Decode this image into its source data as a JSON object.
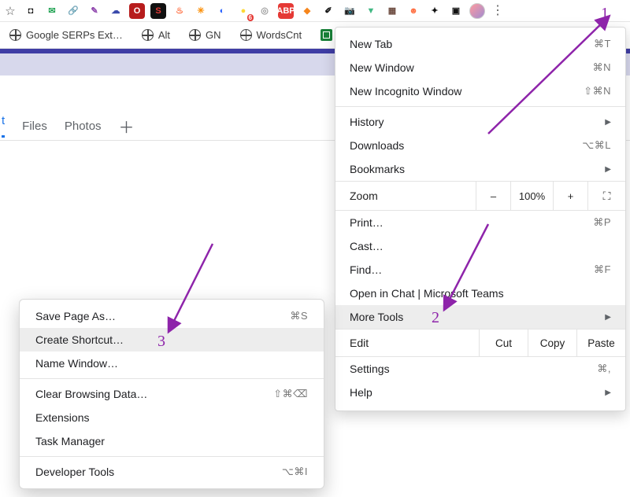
{
  "toolbar": {
    "extensions": [
      {
        "name": "onepass",
        "bg": "#fff",
        "fg": "#111",
        "glyph": "◘"
      },
      {
        "name": "mail",
        "bg": "#fff",
        "fg": "#23a455",
        "glyph": "✉"
      },
      {
        "name": "link",
        "bg": "#fff",
        "fg": "#2aa9e0",
        "glyph": "🔗"
      },
      {
        "name": "feather",
        "bg": "#fff",
        "fg": "#8e44ad",
        "glyph": "✎"
      },
      {
        "name": "bubble",
        "bg": "#fff",
        "fg": "#3949ab",
        "glyph": "☁"
      },
      {
        "name": "ublock",
        "bg": "#b71c1c",
        "fg": "#fff",
        "glyph": "O"
      },
      {
        "name": "seo",
        "bg": "#111",
        "fg": "#e53935",
        "glyph": "S"
      },
      {
        "name": "flame",
        "bg": "#fff",
        "fg": "#ff7043",
        "glyph": "♨"
      },
      {
        "name": "gear",
        "bg": "#fff",
        "fg": "#fb8c00",
        "glyph": "✳"
      },
      {
        "name": "similarweb",
        "bg": "#fff",
        "fg": "#2962ff",
        "glyph": "◐"
      },
      {
        "name": "bulb",
        "bg": "#fff",
        "fg": "#fdd835",
        "glyph": "●",
        "badge": "6"
      },
      {
        "name": "shield",
        "bg": "#fff",
        "fg": "#9e9e9e",
        "glyph": "◎"
      },
      {
        "name": "adblock",
        "bg": "#e53935",
        "fg": "#fff",
        "glyph": "ABP"
      },
      {
        "name": "metamask",
        "bg": "#fff",
        "fg": "#f6851b",
        "glyph": "◆"
      },
      {
        "name": "picker",
        "bg": "#fff",
        "fg": "#111",
        "glyph": "✐"
      },
      {
        "name": "camera",
        "bg": "#fff",
        "fg": "#555",
        "glyph": "📷"
      },
      {
        "name": "vue",
        "bg": "#fff",
        "fg": "#41b883",
        "glyph": "▼"
      },
      {
        "name": "squares",
        "bg": "#fff",
        "fg": "#6d4c41",
        "glyph": "▦"
      },
      {
        "name": "robot",
        "bg": "#fff",
        "fg": "#ff7043",
        "glyph": "☻"
      },
      {
        "name": "puzzle",
        "bg": "#fff",
        "fg": "#111",
        "glyph": "✦"
      },
      {
        "name": "devices",
        "bg": "#fff",
        "fg": "#111",
        "glyph": "▣"
      }
    ]
  },
  "bookmarks": [
    {
      "label": "Google SERPs Ext…"
    },
    {
      "label": "Alt"
    },
    {
      "label": "GN"
    },
    {
      "label": "WordsCnt"
    }
  ],
  "page_tabs": {
    "t1": "t",
    "t2": "Files",
    "t3": "Photos"
  },
  "menu": {
    "new_tab": {
      "label": "New Tab",
      "shortcut": "⌘T"
    },
    "new_window": {
      "label": "New Window",
      "shortcut": "⌘N"
    },
    "new_incognito": {
      "label": "New Incognito Window",
      "shortcut": "⇧⌘N"
    },
    "history": {
      "label": "History"
    },
    "downloads": {
      "label": "Downloads",
      "shortcut": "⌥⌘L"
    },
    "bookmarks": {
      "label": "Bookmarks"
    },
    "zoom": {
      "label": "Zoom",
      "value": "100%",
      "minus": "–",
      "plus": "+"
    },
    "print": {
      "label": "Print…",
      "shortcut": "⌘P"
    },
    "cast": {
      "label": "Cast…"
    },
    "find": {
      "label": "Find…",
      "shortcut": "⌘F"
    },
    "open_chat": {
      "label": "Open in Chat | Microsoft Teams"
    },
    "more_tools": {
      "label": "More Tools"
    },
    "edit": {
      "label": "Edit",
      "cut": "Cut",
      "copy": "Copy",
      "paste": "Paste"
    },
    "settings": {
      "label": "Settings",
      "shortcut": "⌘,"
    },
    "help": {
      "label": "Help"
    }
  },
  "submenu": {
    "save_as": {
      "label": "Save Page As…",
      "shortcut": "⌘S"
    },
    "create_shortcut": {
      "label": "Create Shortcut…"
    },
    "name_window": {
      "label": "Name Window…"
    },
    "clear": {
      "label": "Clear Browsing Data…",
      "shortcut": "⇧⌘⌫"
    },
    "extensions": {
      "label": "Extensions"
    },
    "task_mgr": {
      "label": "Task Manager"
    },
    "devtools": {
      "label": "Developer Tools",
      "shortcut": "⌥⌘I"
    }
  },
  "annotations": {
    "n1": "1",
    "n2": "2",
    "n3": "3"
  }
}
